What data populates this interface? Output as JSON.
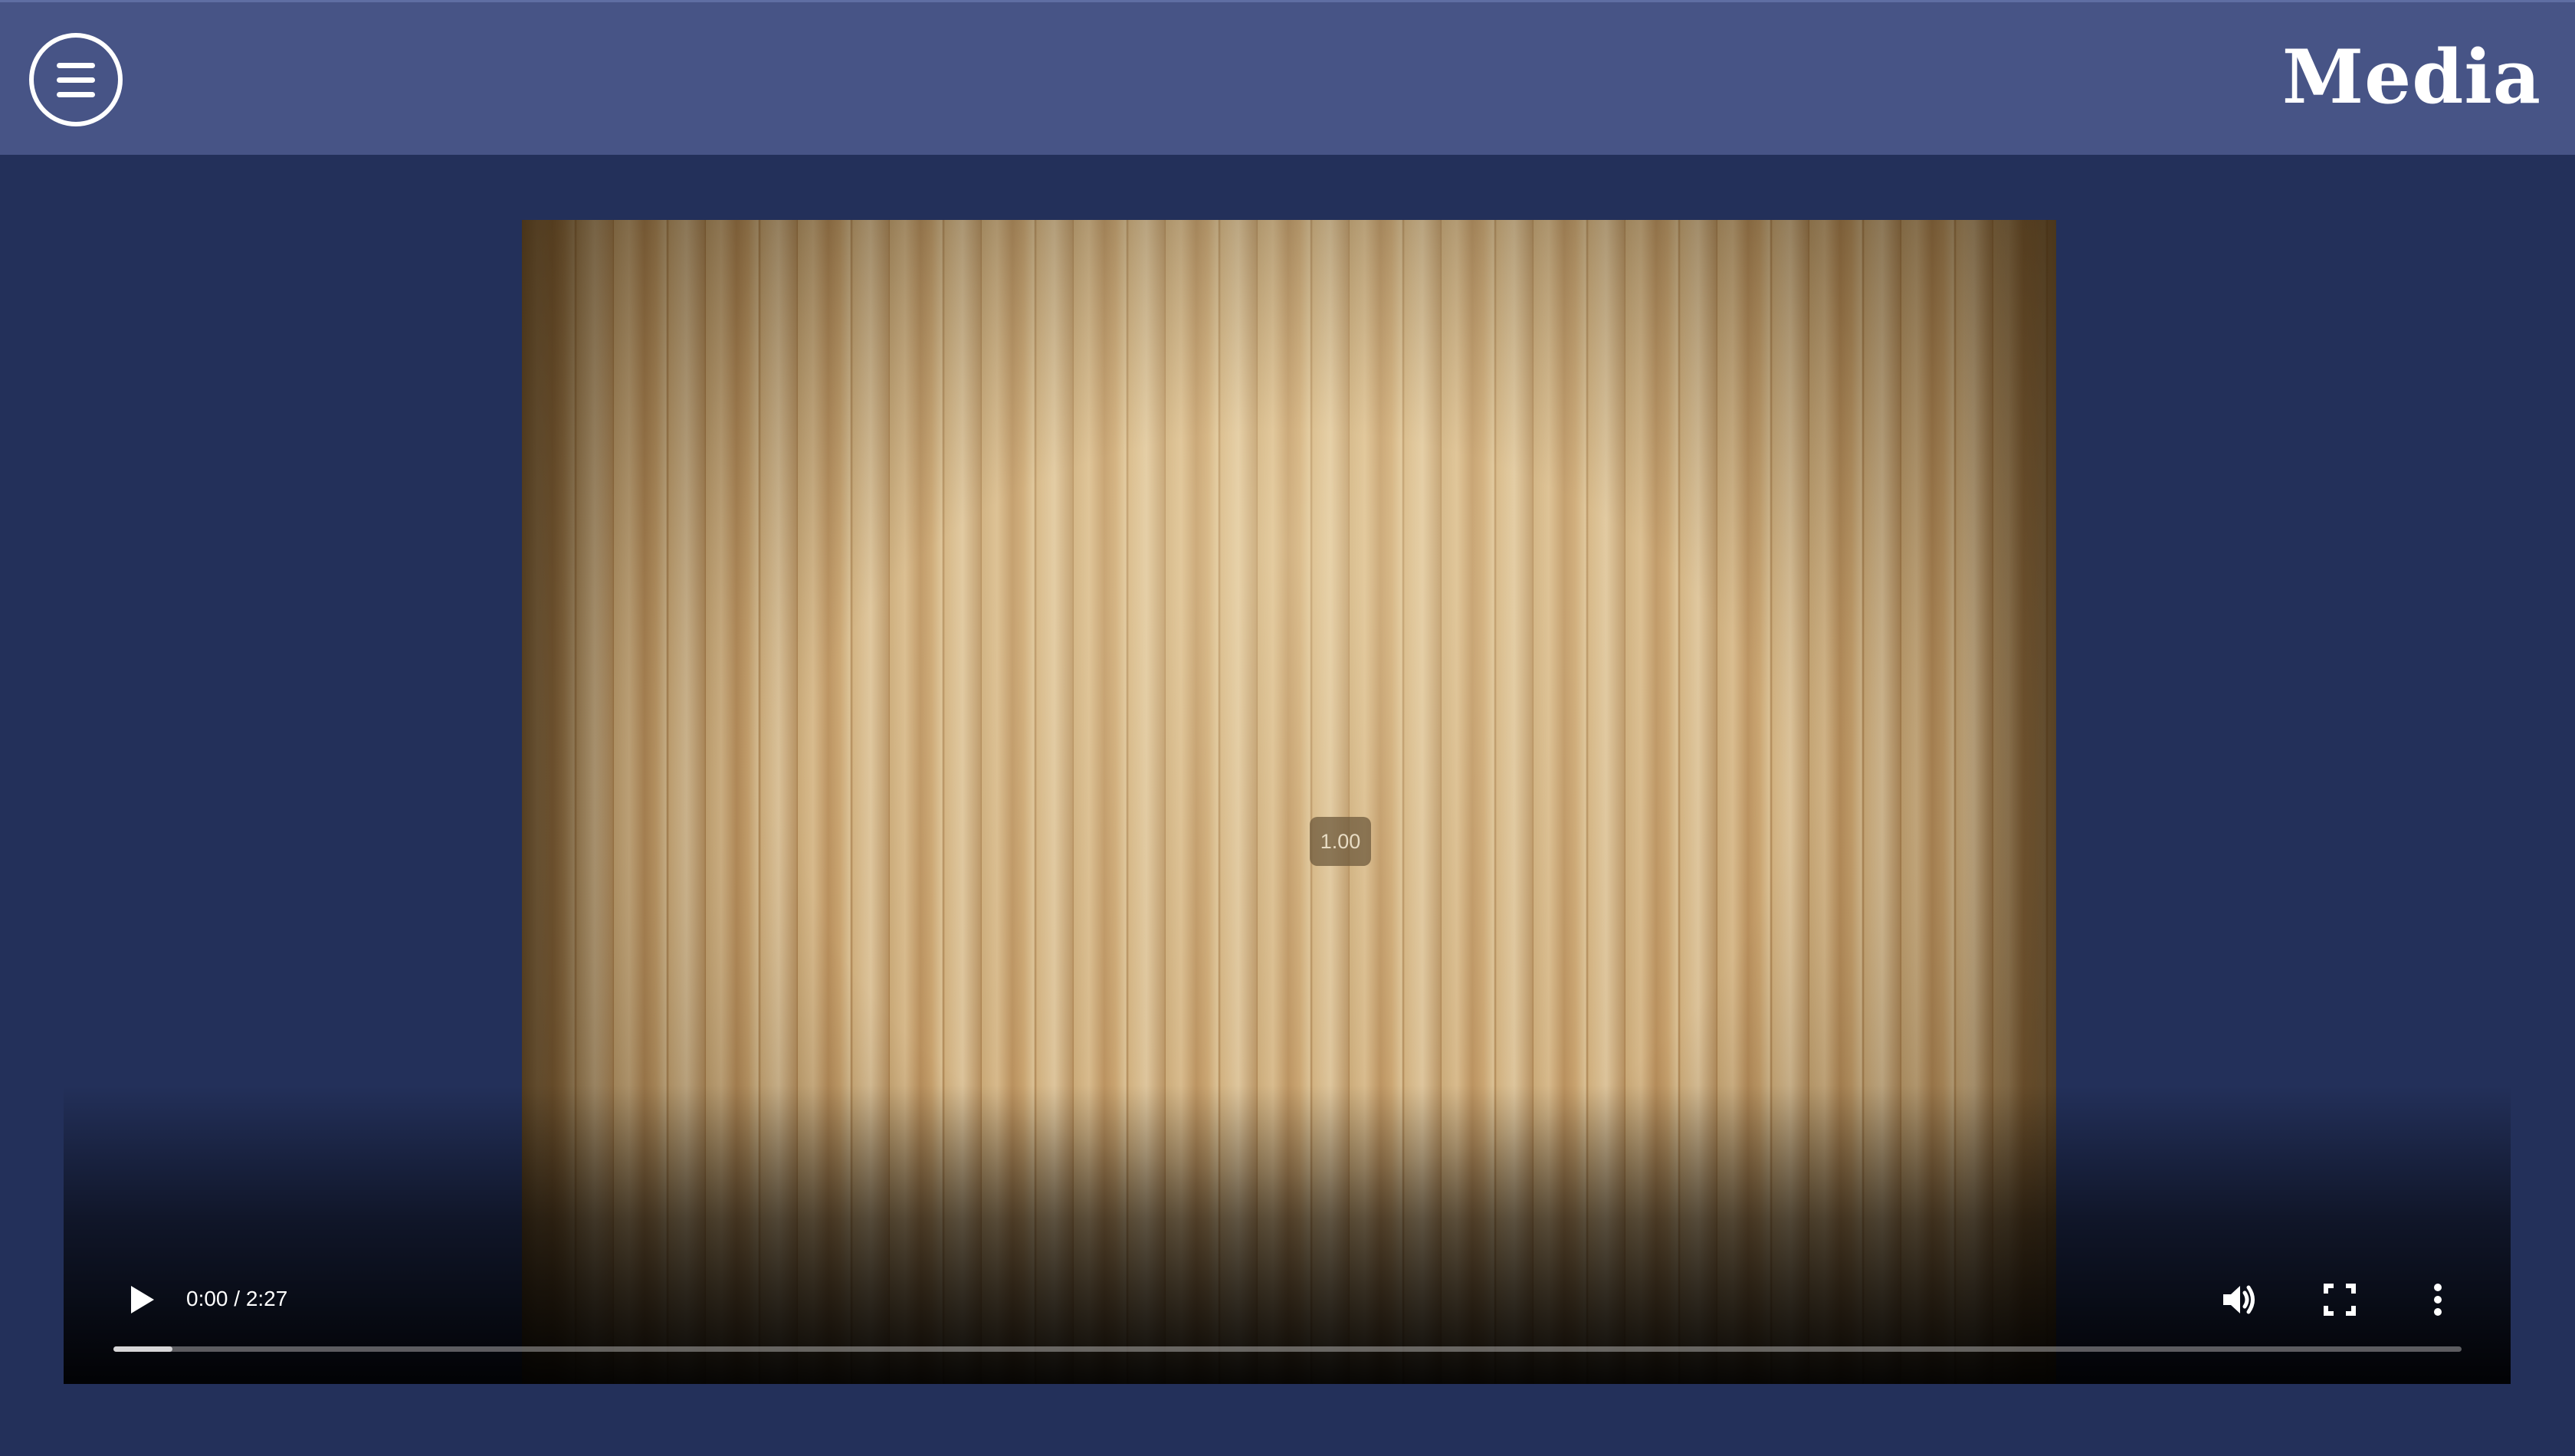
{
  "header": {
    "title": "Media",
    "menu_icon": "hamburger-menu-icon"
  },
  "player": {
    "speed_badge": "1.00",
    "time_display": "0:00 / 2:27",
    "buffered_fraction": 0.025,
    "icons": {
      "play": "play-icon",
      "volume": "volume-icon",
      "fullscreen": "fullscreen-icon",
      "more": "more-options-icon"
    }
  },
  "colors": {
    "header_bg": "#475486",
    "page_bg": "#23305a",
    "icon": "#ffffff"
  }
}
